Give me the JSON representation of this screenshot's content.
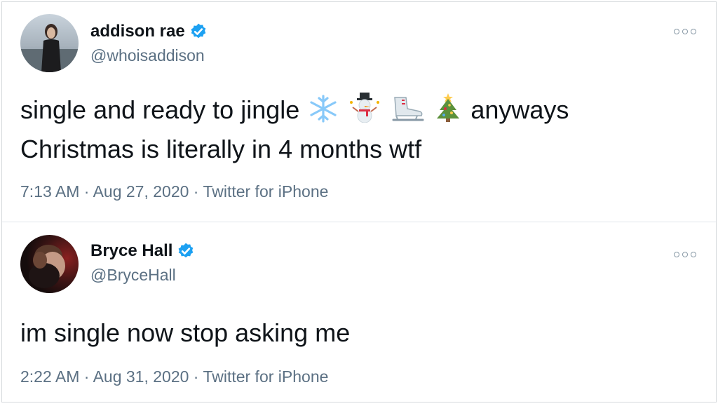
{
  "tweets": [
    {
      "name": "addison rae",
      "handle": "@whoisaddison",
      "verified": true,
      "text_before_emoji": "single and ready to jingle",
      "emojis": [
        "snowflake-icon",
        "snowman-icon",
        "ice-skate-icon",
        "christmas-tree-icon"
      ],
      "text_after_emoji": "anyways",
      "text_line2": "Christmas is literally in 4 months wtf",
      "time": "7:13 AM",
      "date": "Aug 27, 2020",
      "source": "Twitter for iPhone"
    },
    {
      "name": "Bryce Hall",
      "handle": "@BryceHall",
      "verified": true,
      "text": "im single now stop asking me",
      "time": "2:22 AM",
      "date": "Aug 31, 2020",
      "source": "Twitter for iPhone"
    }
  ],
  "separator": " · ",
  "colors": {
    "verified_blue": "#1da1f2",
    "secondary_text": "#5b7083",
    "primary_text": "#0f1419"
  }
}
